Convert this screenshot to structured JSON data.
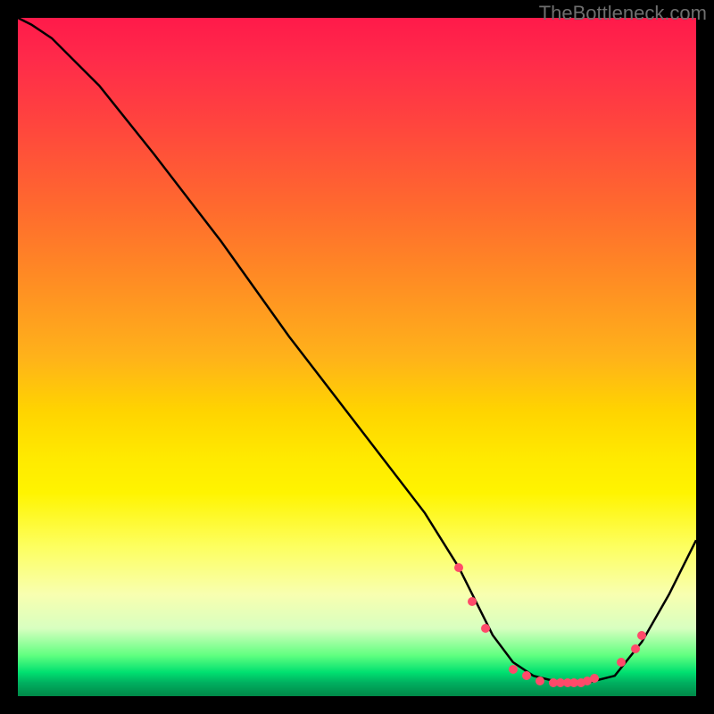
{
  "attribution": "TheBottleneck.com",
  "chart_data": {
    "type": "line",
    "title": "",
    "xlabel": "",
    "ylabel": "",
    "xlim": [
      0,
      100
    ],
    "ylim": [
      0,
      100
    ],
    "background_gradient": [
      "#ff1a4a",
      "#ff6a2e",
      "#ffea00",
      "#00e070"
    ],
    "series": [
      {
        "name": "curve",
        "x": [
          0,
          2,
          5,
          8,
          12,
          20,
          30,
          40,
          50,
          60,
          65,
          68,
          70,
          73,
          76,
          80,
          84,
          88,
          92,
          96,
          100
        ],
        "y": [
          100,
          99,
          97,
          94,
          90,
          80,
          67,
          53,
          40,
          27,
          19,
          13,
          9,
          5,
          3,
          2,
          2,
          3,
          8,
          15,
          23
        ],
        "color": "#000000"
      }
    ],
    "dots": [
      {
        "x": 65,
        "y": 19
      },
      {
        "x": 67,
        "y": 14
      },
      {
        "x": 69,
        "y": 10
      },
      {
        "x": 73,
        "y": 4
      },
      {
        "x": 75,
        "y": 3
      },
      {
        "x": 77,
        "y": 2.3
      },
      {
        "x": 79,
        "y": 2
      },
      {
        "x": 80,
        "y": 2
      },
      {
        "x": 81,
        "y": 2
      },
      {
        "x": 82,
        "y": 2
      },
      {
        "x": 83,
        "y": 2
      },
      {
        "x": 84,
        "y": 2.3
      },
      {
        "x": 85,
        "y": 2.6
      },
      {
        "x": 89,
        "y": 5
      },
      {
        "x": 91,
        "y": 7
      },
      {
        "x": 92,
        "y": 9
      }
    ]
  }
}
